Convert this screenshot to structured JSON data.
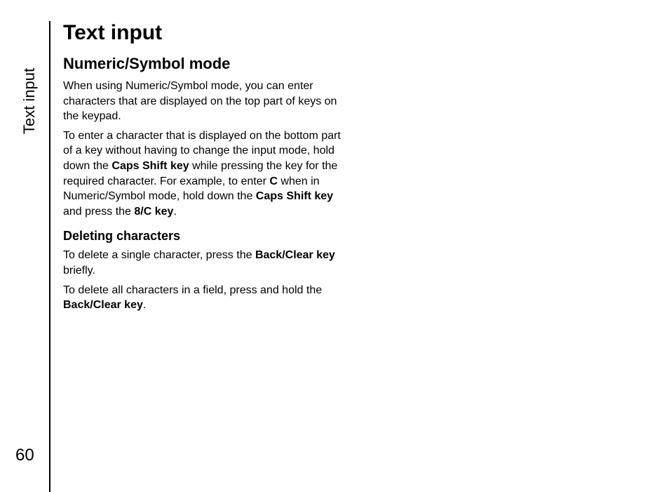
{
  "sidebar": {
    "label": "Text input"
  },
  "page_number": "60",
  "content": {
    "title": "Text input",
    "section1": {
      "heading": "Numeric/Symbol mode",
      "p1": "When using Numeric/Symbol mode, you can enter characters that are displayed on the top part of keys on the keypad.",
      "p2a": "To enter a character that is displayed on the bottom part of a key without having to change the input mode, hold down the ",
      "p2_b1": "Caps Shift key",
      "p2b": " while pressing the key for the required character. For example, to enter ",
      "p2_b2": "C",
      "p2c": " when in Numeric/Symbol mode, hold down the ",
      "p2_b3": "Caps Shift key",
      "p2d": " and press the ",
      "p2_b4": "8/C key",
      "p2e": "."
    },
    "section2": {
      "heading": "Deleting characters",
      "p1a": "To delete a single character, press the ",
      "p1_b1": "Back/Clear key",
      "p1b": " briefly.",
      "p2a": "To delete all characters in a field, press and hold the ",
      "p2_b1": "Back/Clear key",
      "p2b": "."
    }
  }
}
